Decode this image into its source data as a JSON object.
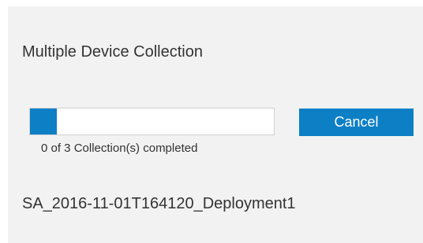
{
  "dialog": {
    "title": "Multiple Device Collection",
    "progress": {
      "completed": 0,
      "total": 3,
      "display_fraction": 0.11,
      "text": "0 of 3 Collection(s) completed"
    },
    "cancel_label": "Cancel",
    "deployment_name": "SA_2016-11-01T164120_Deployment1"
  },
  "colors": {
    "dialog_background": "#f2f2f2",
    "accent": "#0d7fc5",
    "text": "#333333",
    "progress_track": "#ffffff"
  }
}
